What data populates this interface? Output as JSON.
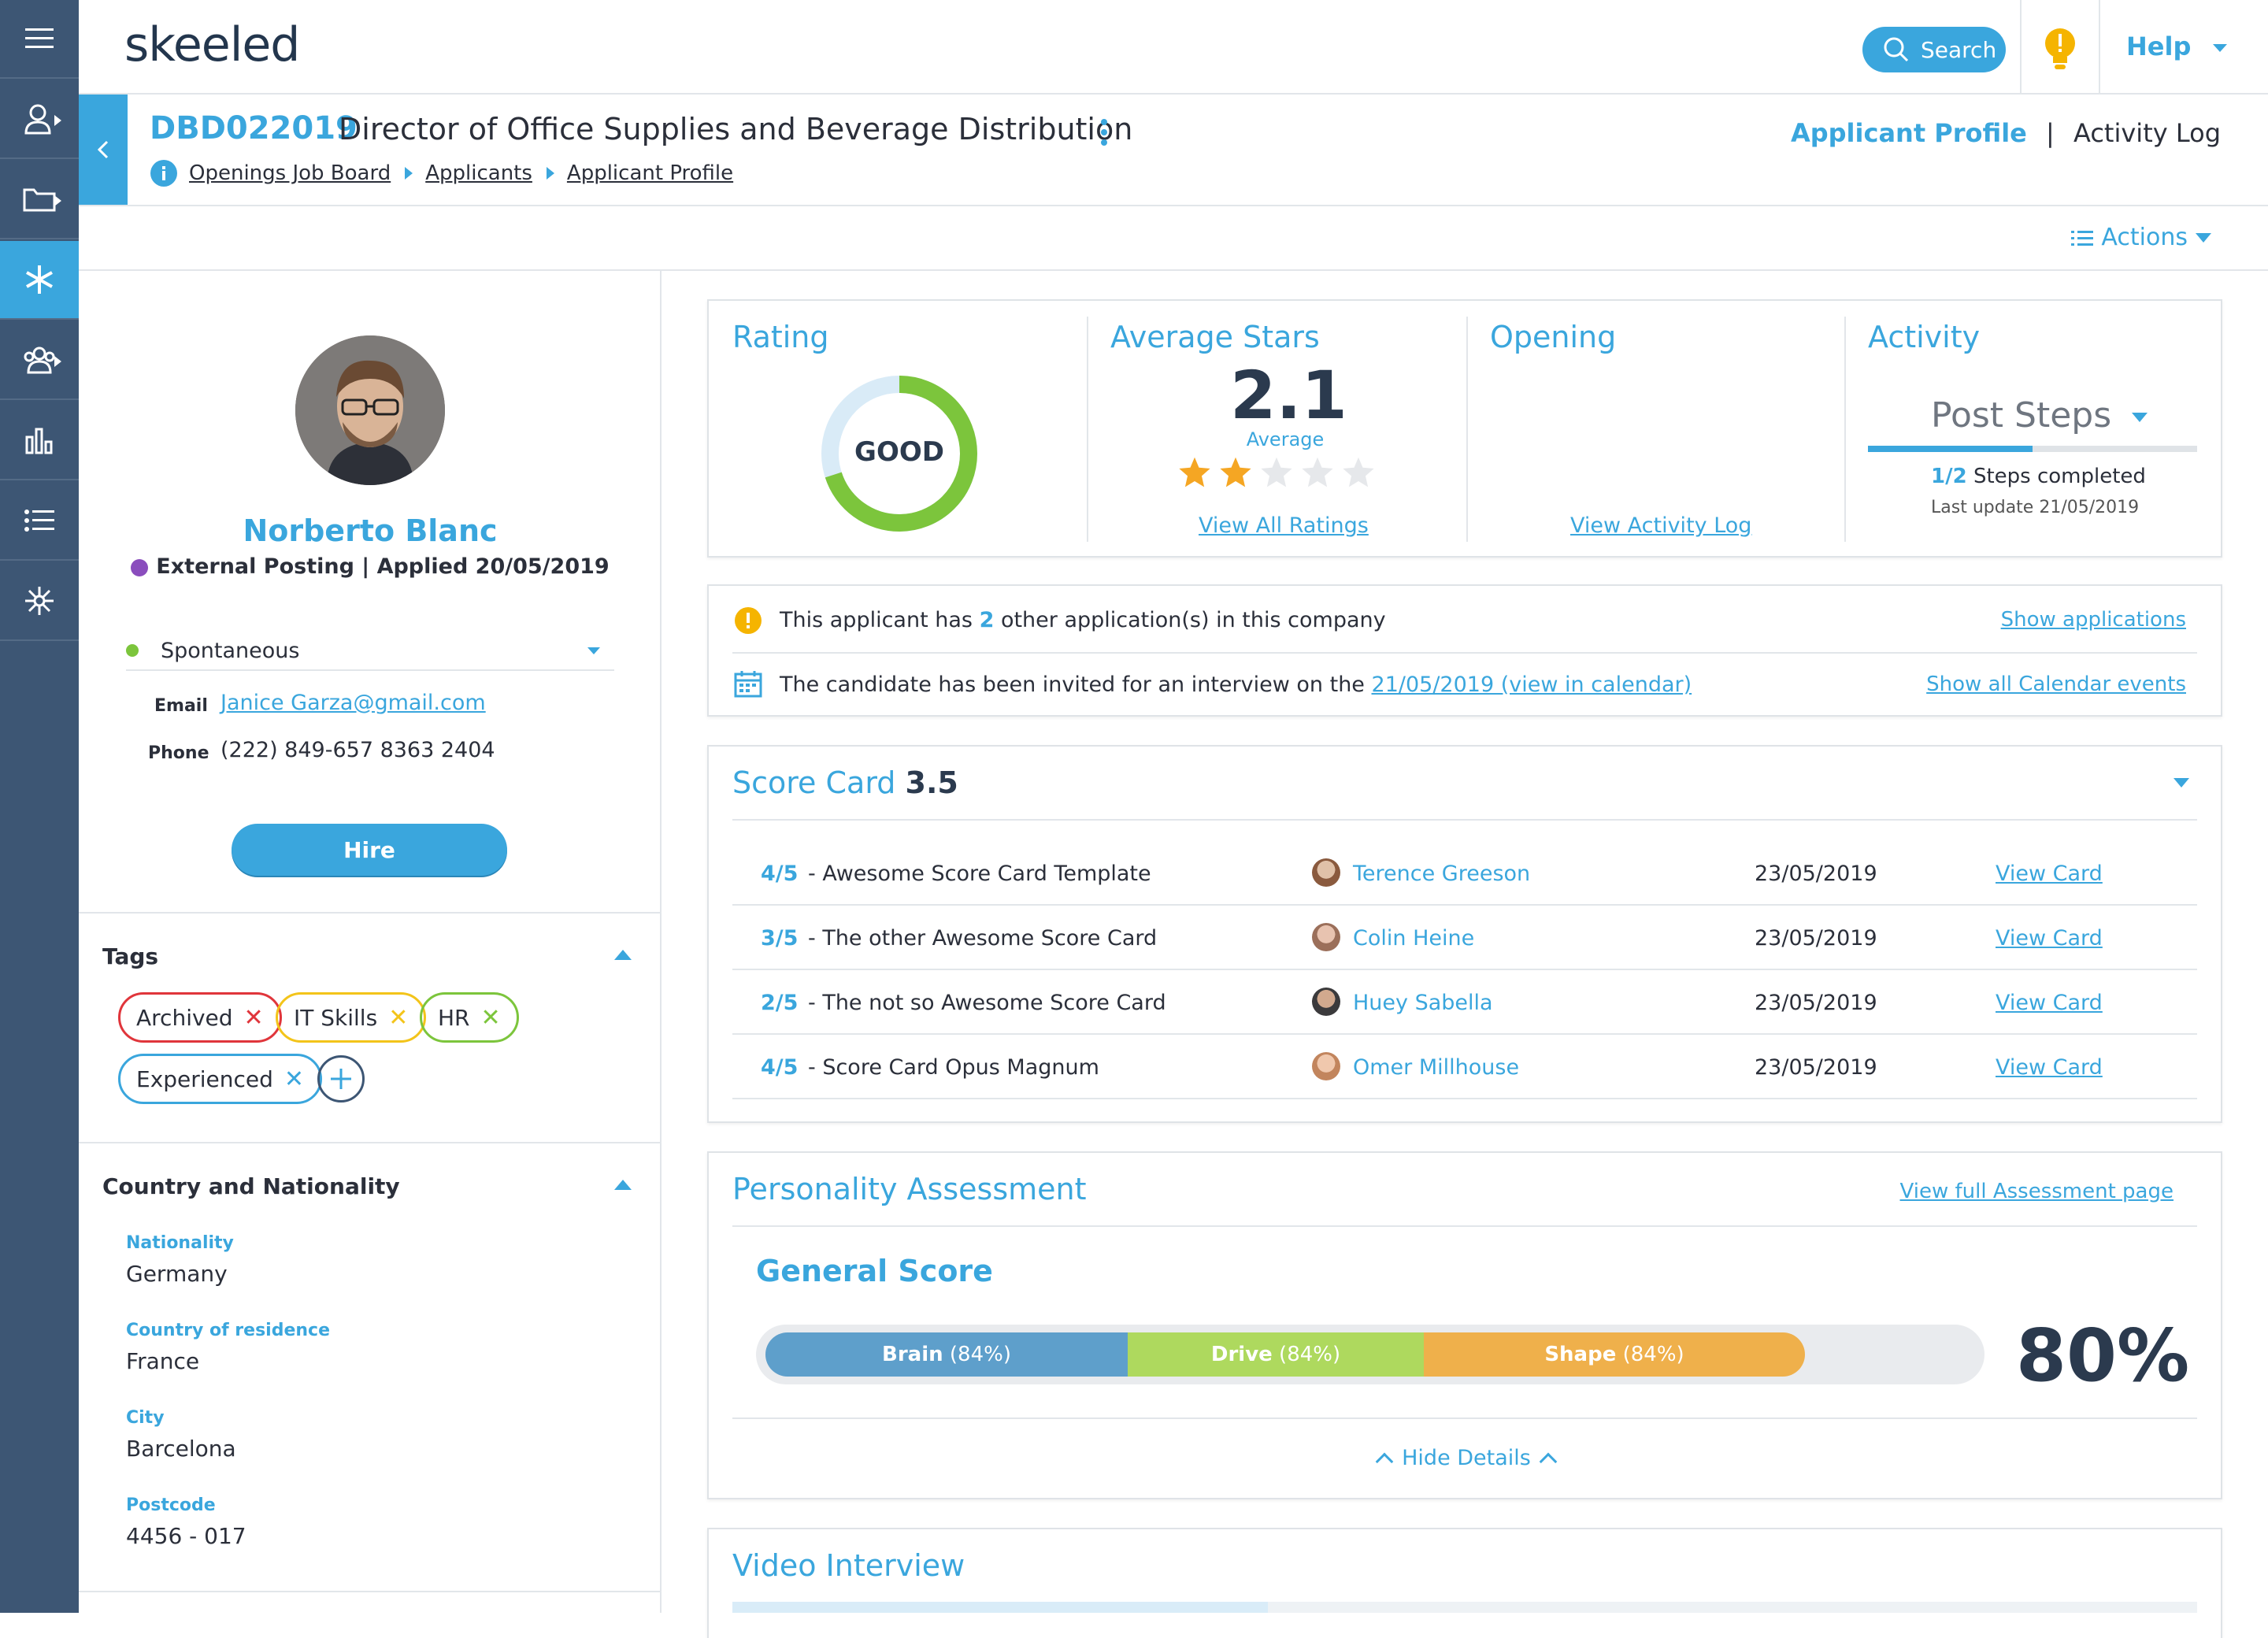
{
  "header": {
    "logo": "skeeled",
    "search_label": "Search",
    "help_label": "Help"
  },
  "rail": {
    "items": [
      "menu-icon",
      "user-icon",
      "folder-icon",
      "asterisk-icon",
      "group-icon",
      "chart-icon",
      "list-icon",
      "network-icon"
    ]
  },
  "job": {
    "code": "DBD022019",
    "title": "Director of Office Supplies and Beverage Distribution",
    "breadcrumbs": [
      "Openings Job Board",
      "Applicants",
      "Applicant Profile"
    ],
    "tab_active": "Applicant Profile",
    "tab_sep": "|",
    "tab_other": "Activity Log",
    "actions_label": "Actions"
  },
  "applicant": {
    "name": "Norberto Blanc",
    "posting": "External Posting | Applied 20/05/2019",
    "status": "Spontaneous",
    "email_label": "Email",
    "email": "Janice Garza@gmail.com",
    "phone_label": "Phone",
    "phone": "(222) 849-657 8363 2404",
    "hire_label": "Hire"
  },
  "tags": {
    "title": "Tags",
    "items": [
      {
        "label": "Archived",
        "color": "#e0353b"
      },
      {
        "label": "IT Skills",
        "color": "#f3c41a"
      },
      {
        "label": "HR",
        "color": "#7cc53c"
      },
      {
        "label": "Experienced",
        "color": "#3aa6dd"
      }
    ],
    "add_icon": "plus-icon"
  },
  "country": {
    "title": "Country and Nationality",
    "fields": [
      {
        "label": "Nationality",
        "value": "Germany"
      },
      {
        "label": "Country of residence",
        "value": "France"
      },
      {
        "label": "City",
        "value": "Barcelona"
      },
      {
        "label": "Postcode",
        "value": "4456 - 017"
      }
    ]
  },
  "summary": {
    "rating_title": "Rating",
    "rating_value": "GOOD",
    "rating_fraction": 0.7,
    "avg_title": "Average Stars",
    "avg_value": "2.1",
    "avg_label": "Average",
    "stars_filled": 2,
    "stars_total": 5,
    "view_ratings": "View All Ratings",
    "opening_title": "Opening",
    "view_activity": "View Activity Log",
    "activity_title": "Activity",
    "post_steps": "Post Steps",
    "steps_progress": 0.5,
    "steps_count": "1/2",
    "steps_text": "Steps completed",
    "last_update": "Last update 21/05/2019"
  },
  "notices": {
    "apps_prefix": "This applicant has ",
    "apps_count": "2",
    "apps_suffix": " other application(s) in this company",
    "show_apps": "Show applications",
    "interview_prefix": "The candidate has been invited for an interview on the ",
    "interview_link": "21/05/2019 (view in calendar)",
    "show_calendar": "Show all Calendar events"
  },
  "scorecard": {
    "title": "Score Card",
    "score": "3.5",
    "rows": [
      {
        "score": "4/5",
        "name": "- Awesome Score Card Template",
        "reviewer": "Terence Greeson",
        "date": "23/05/2019",
        "link": "View Card"
      },
      {
        "score": "3/5",
        "name": "- The other Awesome Score Card",
        "reviewer": "Colin Heine",
        "date": "23/05/2019",
        "link": "View Card"
      },
      {
        "score": "2/5",
        "name": "- The not so Awesome Score Card",
        "reviewer": "Huey Sabella",
        "date": "23/05/2019",
        "link": "View Card"
      },
      {
        "score": "4/5",
        "name": "- Score Card Opus Magnum",
        "reviewer": "Omer Millhouse",
        "date": "23/05/2019",
        "link": "View Card"
      }
    ]
  },
  "personality": {
    "title": "Personality Assessment",
    "full_link": "View full Assessment page",
    "general_title": "General Score",
    "segments": [
      {
        "name": "Brain",
        "pct": "(84%)",
        "color": "#5e9fcb"
      },
      {
        "name": "Drive",
        "pct": "(84%)",
        "color": "#aed95e"
      },
      {
        "name": "Shape",
        "pct": "(84%)",
        "color": "#efb04b"
      }
    ],
    "overall": "80%",
    "overall_value": 0.8,
    "hide_details": "Hide Details"
  },
  "video": {
    "title": "Video Interview"
  }
}
